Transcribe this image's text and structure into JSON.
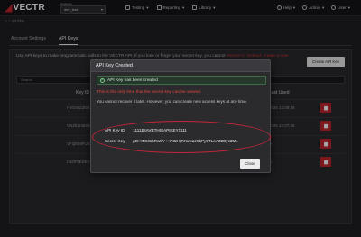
{
  "header": {
    "logo_mark": "◢",
    "logo_text": "VECTR",
    "db_label": "Database",
    "db_value": "dev_test",
    "nav": [
      {
        "label": "Testing",
        "icon": "flask-icon"
      },
      {
        "label": "Reporting",
        "icon": "chart-icon"
      },
      {
        "label": "Library",
        "icon": "book-icon"
      }
    ],
    "nav_right": [
      {
        "label": "Help",
        "icon": "help-icon"
      },
      {
        "label": "Admin",
        "icon": "gear-icon"
      },
      {
        "label": "User",
        "icon": "user-icon"
      }
    ]
  },
  "breadcrumb": {
    "home": "⌂",
    "sep": "/",
    "current": "Api Keys"
  },
  "tabs": [
    {
      "label": "Account Settings",
      "active": false
    },
    {
      "label": "API Keys",
      "active": true
    }
  ],
  "page": {
    "intro_prefix": "Use API keys to make programmatic calls to the VECTR API. If you lose or forget your secret key, you cannot",
    "intro_warn": "retrieve it. Instead, create a new ",
    "create_button": "Create API Key",
    "search_placeholder": "Search",
    "columns": {
      "key_id": "Key ID",
      "last_used": "Last Used"
    },
    "rows": [
      {
        "key_id": "HVGWZ2ER3SD",
        "last_used": "6/2025 12:08:16"
      },
      {
        "key_id": "VNZEG46XMFVS2",
        "last_used": "6/2025 12:07:26"
      },
      {
        "key_id": "VFQMMFUS6F2",
        "last_used": "N/A"
      },
      {
        "key_id": "ISDRYEDEY8K7",
        "last_used": "N/A"
      }
    ]
  },
  "modal": {
    "title": "API Key Created",
    "success": "API Key has been created",
    "warning": "This is the only time that the secret key can be viewed.",
    "info": "You cannot recover it later. However, you can create new access keys at any time.",
    "key_id_label": "API Key ID",
    "key_id_value": "11111SAVETHISAPIKEY1111",
    "secret_label": "Secret Key",
    "secret_value": "pt9+MS3shRw9Y++P3zHjRXuwazKkPy9TLoAZ2Byc3M=",
    "close_button": "Close"
  },
  "colors": {
    "accent_red": "#c0272d",
    "annotation_ring": "#c3263a",
    "success_green": "#7ccf8c"
  }
}
